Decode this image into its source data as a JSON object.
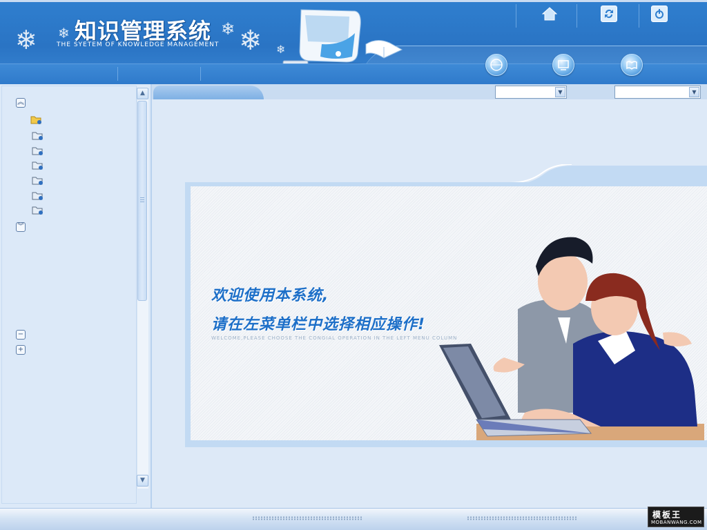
{
  "header": {
    "title_cn": "知识管理系统",
    "title_en": "THE SYETEM OF KNOWLEDGE MANAGEMENT",
    "top_icons": [
      "home-icon",
      "refresh-icon",
      "logout-icon"
    ],
    "nav_buttons": [
      "nav-button-1-icon",
      "nav-button-2-icon",
      "nav-button-3-icon"
    ]
  },
  "sidebar": {
    "expand_all_icon": "double-chevron-up-icon",
    "collapse_all_icon": "double-chevron-down-icon",
    "tree_items": [
      {
        "icon": "open-folder-icon"
      },
      {
        "icon": "folder-icon"
      },
      {
        "icon": "folder-icon"
      },
      {
        "icon": "folder-icon"
      },
      {
        "icon": "folder-icon"
      },
      {
        "icon": "folder-icon"
      },
      {
        "icon": "folder-icon"
      }
    ],
    "minus_icon": "minus-box-icon",
    "plus_icon": "plus-box-icon"
  },
  "toolbar": {
    "select_1_value": "",
    "select_2_value": ""
  },
  "welcome": {
    "line1": "欢迎使用本系统,",
    "line2": "请在左菜单栏中选择相应操作!",
    "english": "WELCOME,PLEASE CHOOSE THE CONGIAL OPERATION IN THE LEFT MENU COLUMN"
  },
  "watermark": {
    "cn": "模板王",
    "en": "MOBANWANG.COM"
  },
  "colors": {
    "header_blue": "#2f7fcf",
    "panel_bg": "#dde9f7",
    "welcome_text": "#1d6fc8"
  }
}
